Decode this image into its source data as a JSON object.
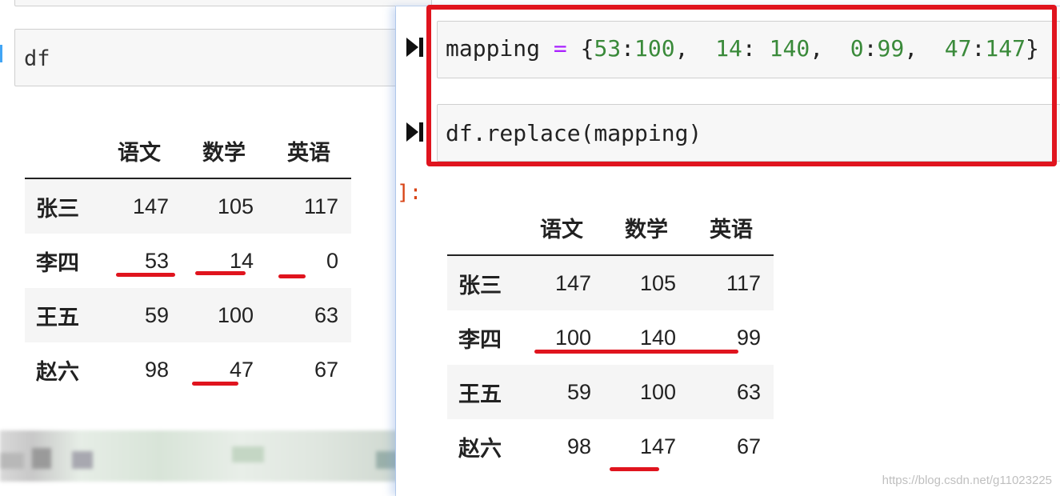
{
  "left_notebook": {
    "input_code": "df",
    "table": {
      "columns": [
        "语文",
        "数学",
        "英语"
      ],
      "rows": [
        {
          "index": "张三",
          "values": [
            "147",
            "105",
            "117"
          ]
        },
        {
          "index": "李四",
          "values": [
            "53",
            "14",
            "0"
          ]
        },
        {
          "index": "王五",
          "values": [
            "59",
            "100",
            "63"
          ]
        },
        {
          "index": "赵六",
          "values": [
            "98",
            "47",
            "67"
          ]
        }
      ]
    }
  },
  "right_panel": {
    "cell1": {
      "var": "mapping",
      "op": "=",
      "code_tokens": [
        "{",
        "53",
        ":",
        "100",
        ",  ",
        "14",
        ": ",
        "140",
        ",  ",
        "0",
        ":",
        "99",
        ",  ",
        "47",
        ":",
        "147",
        "}"
      ]
    },
    "cell2": {
      "code": "df.replace(mapping)"
    },
    "output_prompt": "]:",
    "table": {
      "columns": [
        "语文",
        "数学",
        "英语"
      ],
      "rows": [
        {
          "index": "张三",
          "values": [
            "147",
            "105",
            "117"
          ]
        },
        {
          "index": "李四",
          "values": [
            "100",
            "140",
            "99"
          ]
        },
        {
          "index": "王五",
          "values": [
            "59",
            "100",
            "63"
          ]
        },
        {
          "index": "赵六",
          "values": [
            "98",
            "147",
            "67"
          ]
        }
      ]
    }
  },
  "watermark": "https://blog.csdn.net/g11023225",
  "colors": {
    "annotation_red": "#e0141e",
    "keyword_purple": "#aa22ff",
    "number_green": "#3a8a3a",
    "prompt_orange": "#d84315"
  },
  "icons": {
    "run_cell": "step-forward-icon"
  }
}
